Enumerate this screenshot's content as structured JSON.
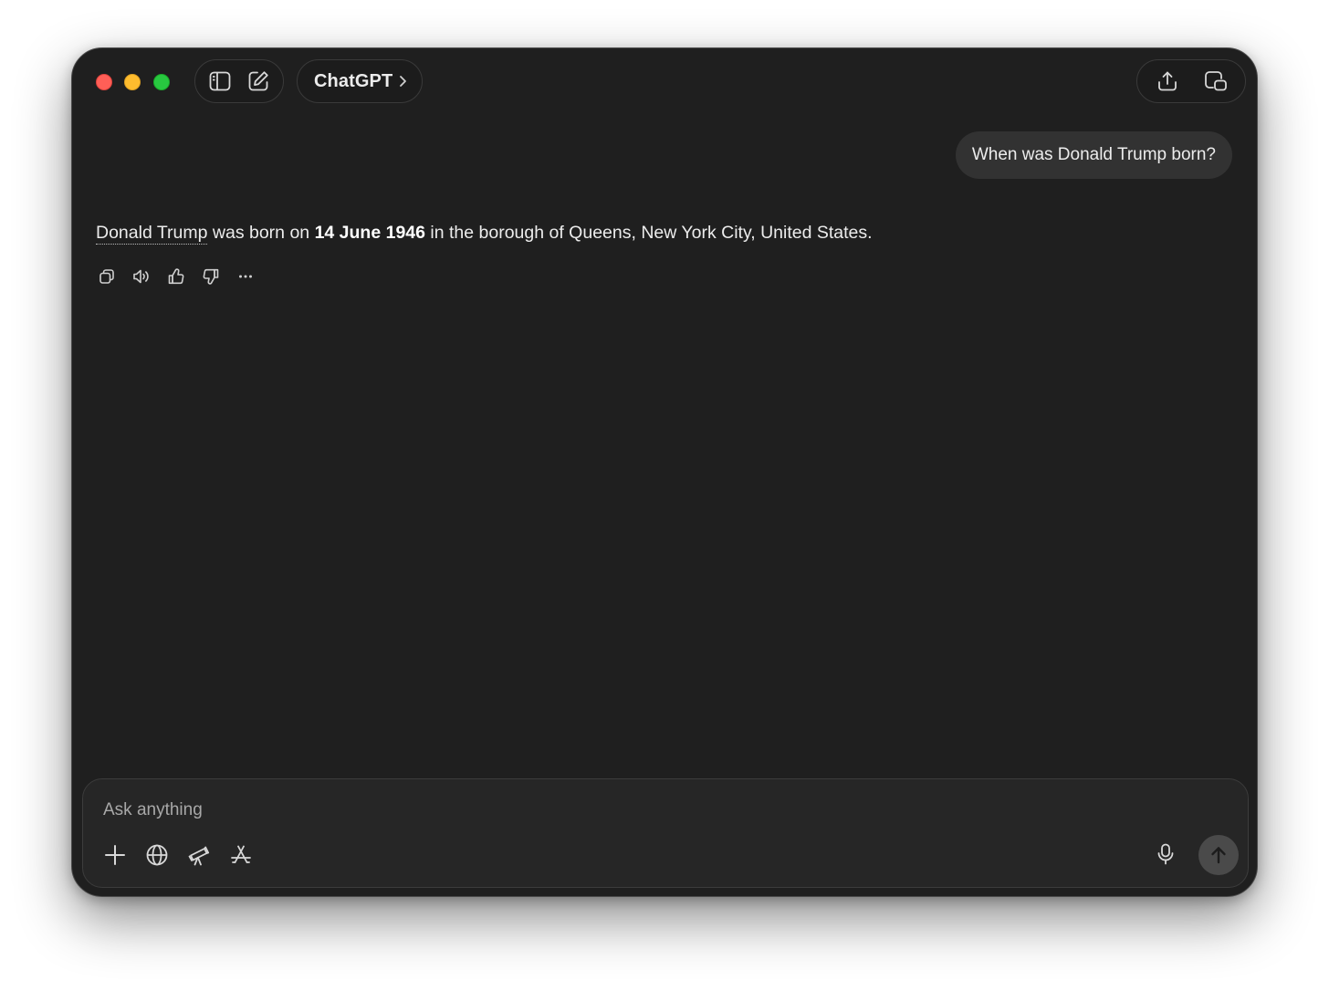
{
  "window": {
    "title": "ChatGPT",
    "controls": [
      "close",
      "minimize",
      "maximize"
    ]
  },
  "toolbar": {
    "left_icons": [
      "sidebar-toggle-icon",
      "new-chat-icon"
    ],
    "right_icons": [
      "share-icon",
      "window-popout-icon"
    ]
  },
  "conversation": {
    "user_message": "When was Donald Trump born?",
    "assistant_message": {
      "link_text": "Donald Trump",
      "text_before_bold": " was born on ",
      "bold_text": "14 June 1946",
      "text_after_bold": " in the borough of Queens, New York City, United States."
    },
    "action_icons": [
      "copy-icon",
      "read-aloud-icon",
      "thumbs-up-icon",
      "thumbs-down-icon",
      "more-icon"
    ]
  },
  "composer": {
    "placeholder": "Ask anything",
    "tool_icons": [
      "plus-icon",
      "globe-icon",
      "telescope-icon",
      "app-store-icon"
    ],
    "mic_icon": "microphone-icon",
    "send_icon": "arrow-up-icon"
  },
  "colors": {
    "window_bg": "#1f1f1f",
    "bubble_bg": "#323232",
    "composer_bg": "#262626",
    "text": "#ececec",
    "placeholder": "#a8a8a8",
    "traffic_red": "#ff5f57",
    "traffic_yellow": "#febc2e",
    "traffic_green": "#28c840"
  }
}
